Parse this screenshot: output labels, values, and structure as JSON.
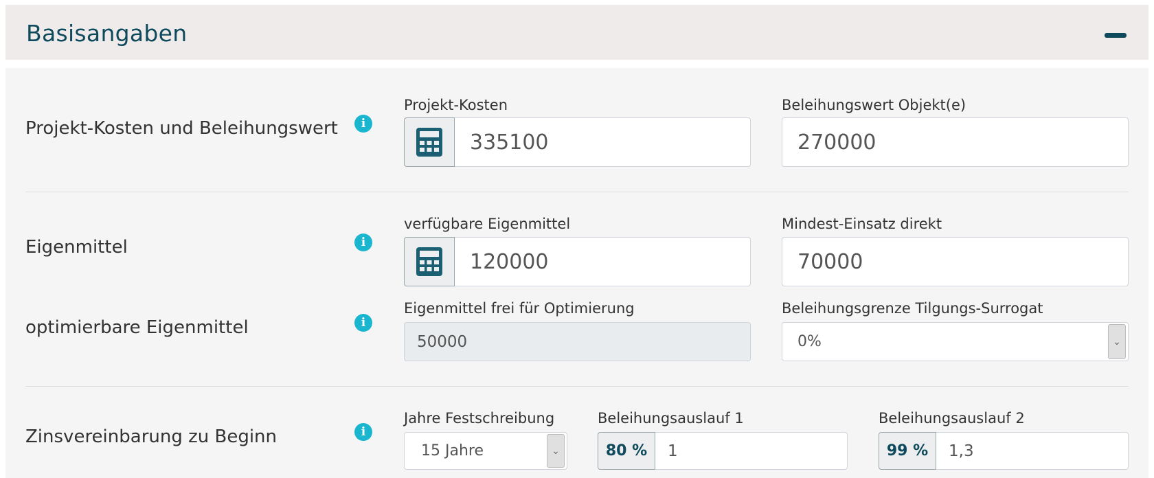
{
  "panel": {
    "title": "Basisangaben",
    "collapse_icon": "minus-icon"
  },
  "colors": {
    "accent": "#0e4a5c",
    "info": "#1ab5cf",
    "header_bg": "#efebea",
    "body_bg": "#f5f5f5"
  },
  "sections": {
    "projekt": {
      "label": "Projekt-Kosten und Beleihungswert",
      "kosten_label": "Projekt-Kosten",
      "kosten_value": "335100",
      "beleihungswert_label": "Beleihungswert Objekt(e)",
      "beleihungswert_value": "270000"
    },
    "eigenmittel": {
      "label": "Eigenmittel",
      "verfuegbar_label": "verfügbare Eigenmittel",
      "verfuegbar_value": "120000",
      "mindest_label": "Mindest-Einsatz direkt",
      "mindest_value": "70000"
    },
    "optimierbar": {
      "label": "optimierbare Eigenmittel",
      "frei_label": "Eigenmittel frei für Optimierung",
      "frei_value": "50000",
      "grenze_label": "Beleihungsgrenze Tilgungs-Surrogat",
      "grenze_value": "0%"
    },
    "zins": {
      "label": "Zinsvereinbarung zu Beginn",
      "festschreibung_label": "Jahre Festschreibung",
      "festschreibung_value": "15 Jahre",
      "auslauf1_label": "Beleihungsauslauf 1",
      "auslauf1_addon": "80 %",
      "auslauf1_value": "1",
      "auslauf2_label": "Beleihungsauslauf 2",
      "auslauf2_addon": "99 %",
      "auslauf2_value": "1,3"
    }
  }
}
